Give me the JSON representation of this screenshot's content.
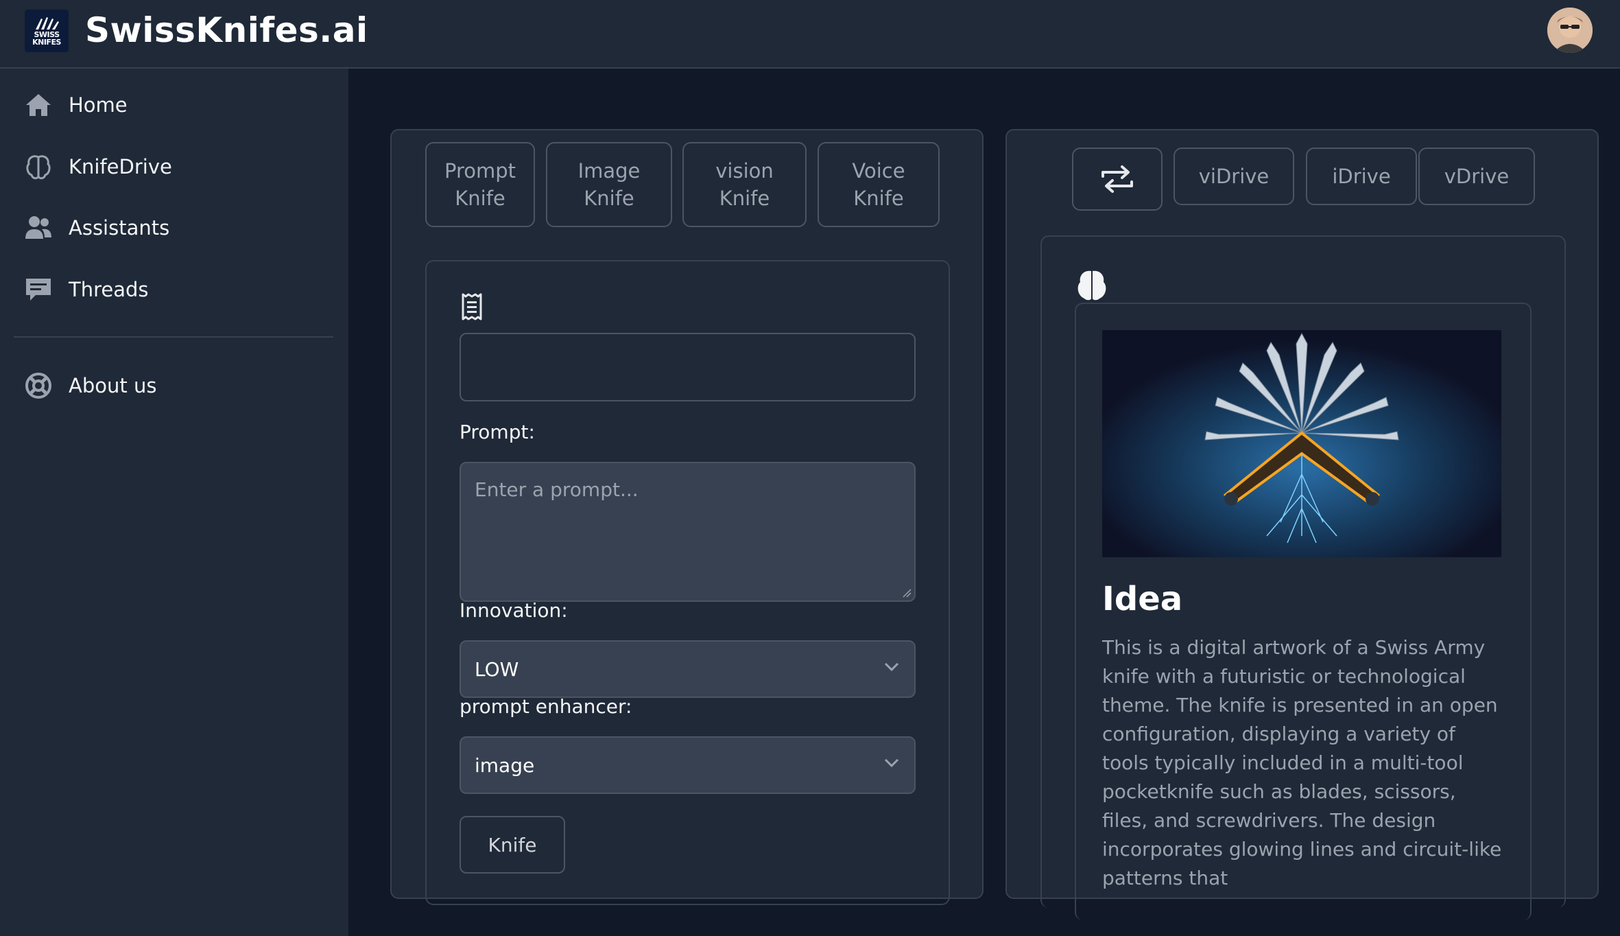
{
  "header": {
    "logo_line1": "SWISS",
    "logo_line2": "KNIFES",
    "title": "SwissKnifes.ai"
  },
  "sidebar": {
    "items": [
      {
        "label": "Home",
        "icon": "home-icon"
      },
      {
        "label": "KnifeDrive",
        "icon": "brain-icon"
      },
      {
        "label": "Assistants",
        "icon": "users-icon"
      },
      {
        "label": "Threads",
        "icon": "chat-icon"
      },
      {
        "label": "About us",
        "icon": "lifebuoy-icon"
      }
    ]
  },
  "knife_tabs": [
    {
      "label": "Prompt Knife"
    },
    {
      "label": "Image Knife"
    },
    {
      "label": "vision Knife"
    },
    {
      "label": "Voice Knife"
    }
  ],
  "form": {
    "icon": "receipt-icon",
    "title_value": "",
    "prompt_label": "Prompt:",
    "prompt_placeholder": "Enter a prompt...",
    "innovation_label": "Innovation:",
    "innovation_value": "LOW",
    "enhancer_label": "prompt enhancer:",
    "enhancer_value": "image",
    "submit_label": "Knife"
  },
  "drive_tabs": {
    "swap_icon": "swap-icon",
    "items": [
      {
        "label": "viDrive"
      },
      {
        "label": "iDrive"
      },
      {
        "label": "vDrive"
      }
    ]
  },
  "result": {
    "icon": "brain-icon",
    "title": "Idea",
    "description": "This is a digital artwork of a Swiss Army knife with a futuristic or technological theme. The knife is presented in an open configuration, displaying a variety of tools typically included in a multi-tool pocketknife such as blades, scissors, files, and screwdrivers. The design incorporates glowing lines and circuit-like patterns that"
  },
  "colors": {
    "page_bg": "#111827",
    "panel_bg": "#1f2937",
    "border": "#374151",
    "text": "#f3f4f6",
    "muted": "#9ca3af"
  }
}
